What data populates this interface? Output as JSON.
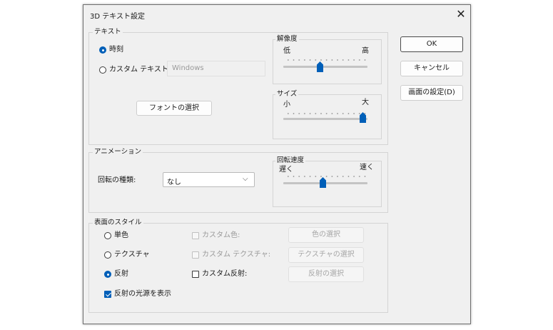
{
  "dialog": {
    "title": "3D テキスト設定",
    "close_glyph": "✕"
  },
  "buttons": {
    "ok": "OK",
    "cancel": "キャンセル",
    "display_settings": "画面の設定(D)"
  },
  "text_group": {
    "label": "テキスト",
    "time_option": "時刻",
    "custom_text_option": "カスタム テキスト:",
    "custom_text_value": "Windows",
    "font_button": "フォントの選択",
    "selected": "time"
  },
  "resolution": {
    "label": "解像度",
    "low": "低",
    "high": "高",
    "level": 0.5
  },
  "size": {
    "label": "サイズ",
    "small": "小",
    "large": "大",
    "level": 1.0
  },
  "animation": {
    "label": "アニメーション",
    "rotation_type_label": "回転の種類:",
    "rotation_type_value": "なし",
    "speed_label": "回転速度",
    "slow": "遅く",
    "fast": "速く",
    "speed_level": 0.5
  },
  "surface": {
    "label": "表面のスタイル",
    "solid": "単色",
    "texture": "テクスチャ",
    "reflection": "反射",
    "custom_color": "カスタム色:",
    "custom_texture": "カスタム テクスチャ:",
    "custom_reflection": "カスタム反射:",
    "choose_color": "色の選択",
    "choose_texture": "テクスチャの選択",
    "choose_reflection": "反射の選択",
    "show_light_source": "反射の光源を表示",
    "selected": "reflection",
    "show_light_source_checked": true
  },
  "colors": {
    "accent": "#005fb8"
  }
}
